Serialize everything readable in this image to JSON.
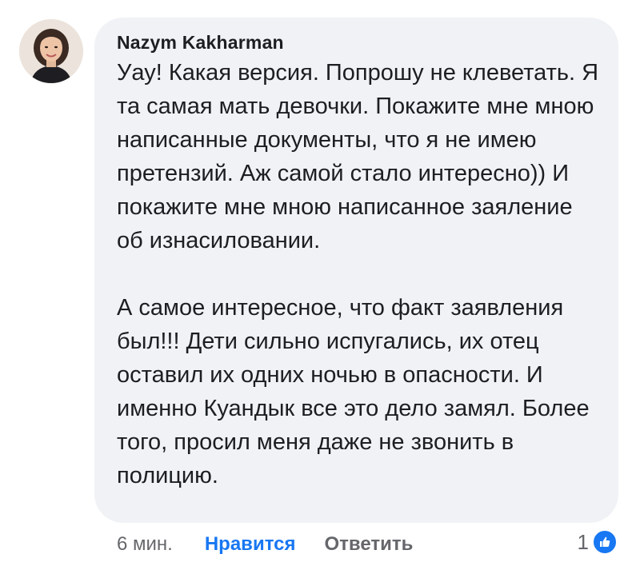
{
  "comment": {
    "author": "Nazym Kakharman",
    "paragraphs": [
      "Уау! Какая версия. Попрошу не клеветать. Я та самая мать девочки. Покажите мне мною написанные документы, что я не имею претензий. Аж самой стало интересно)) И покажите мне мною написанное заяление об изнасиловании.",
      "А самое интересное, что факт заявления был!!! Дети сильно испугались, их отец оставил их одних ночью в опасности. И именно Куандык все это дело замял. Более того, просил меня даже не звонить в полицию."
    ]
  },
  "actions": {
    "time": "6 мин.",
    "like_label": "Нравится",
    "reply_label": "Ответить"
  },
  "reactions": {
    "count": "1",
    "icon": "thumbs-up-icon"
  },
  "colors": {
    "bubble": "#f0f2f5",
    "link_blue": "#1877f2",
    "secondary_text": "#65676b",
    "primary_text": "#1c1e21"
  }
}
